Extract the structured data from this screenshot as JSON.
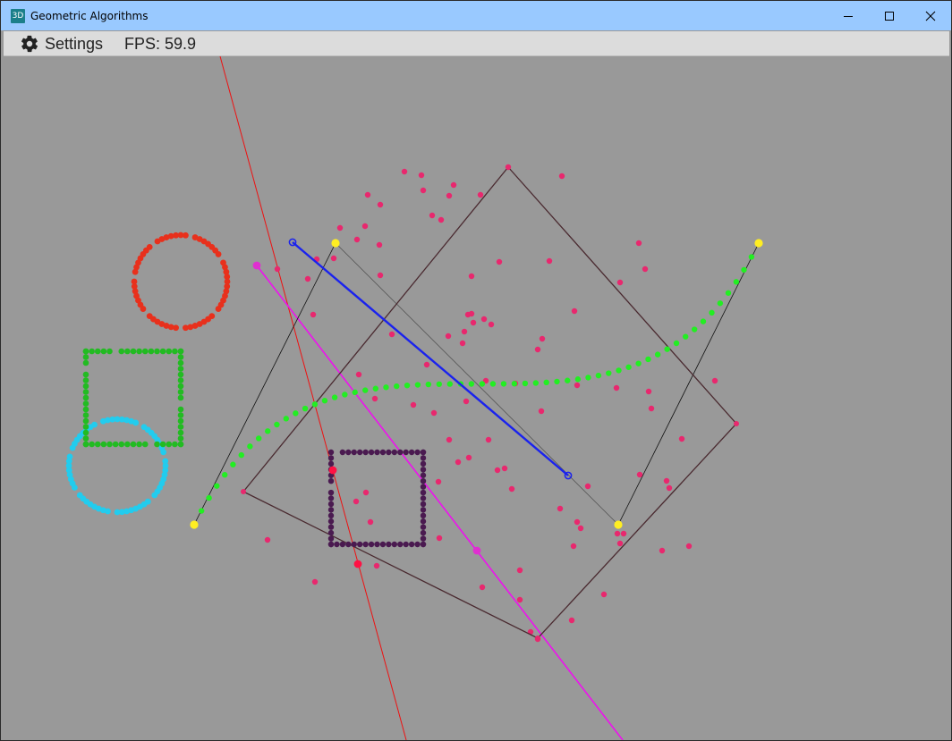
{
  "window": {
    "title": "Geometric Algorithms",
    "app_icon_text": "3D",
    "controls": [
      "minimize",
      "maximize",
      "close"
    ]
  },
  "menu": {
    "settings_label": "Settings",
    "settings_icon": "gear-icon",
    "fps_label": "FPS: 59.9"
  },
  "colors": {
    "titlebar": "#99c9ff",
    "menubar": "#dcdcdc",
    "canvas_background": "#999999",
    "red_circle": "#e8301c",
    "green_square": "#22bb22",
    "cyan_circle": "#22ccee",
    "purple_square": "#4a1a50",
    "pink_points": "#e8286e",
    "convex_hull": "#4a2a30",
    "bezier_curve": "#22ee22",
    "control_points": "#ffee22",
    "blue_segment": "#1a22ee",
    "magenta_line": "#ee11ee",
    "red_line": "#ee1111"
  }
}
